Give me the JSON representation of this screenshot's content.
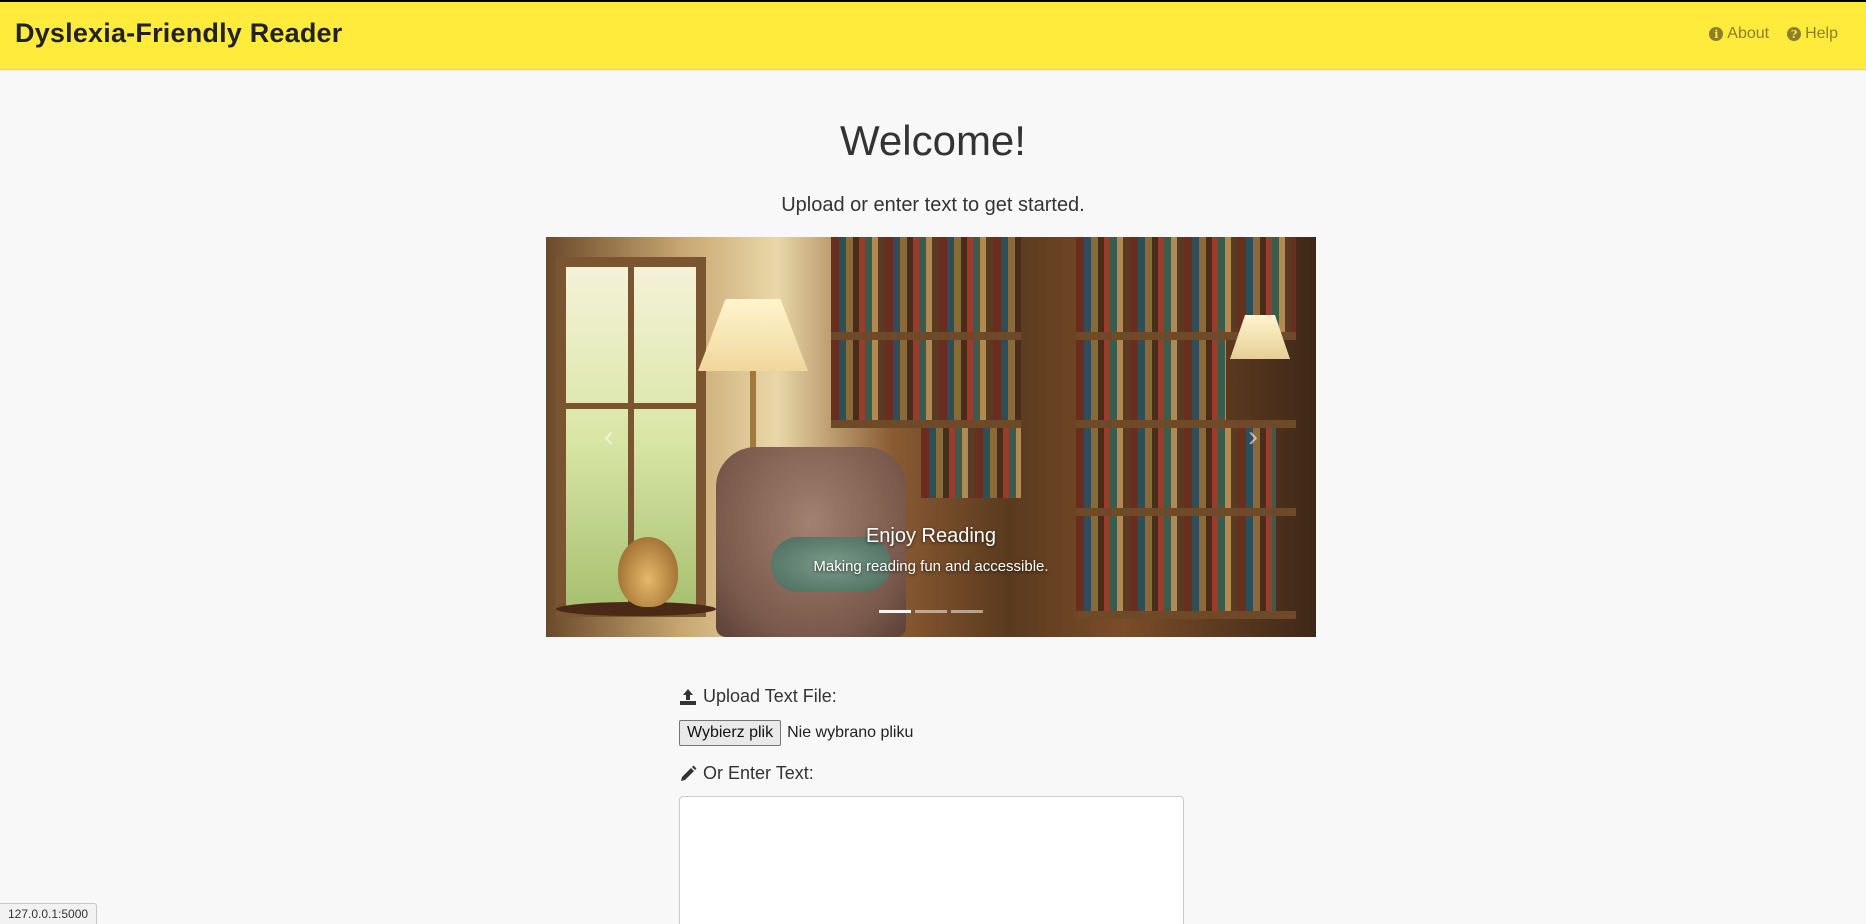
{
  "navbar": {
    "brand": "Dyslexia-Friendly Reader",
    "links": [
      {
        "label": "About",
        "icon": "info-circle-icon"
      },
      {
        "label": "Help",
        "icon": "question-circle-icon"
      }
    ],
    "background": "#ffeb3b"
  },
  "main": {
    "title": "Welcome!",
    "subtitle": "Upload or enter text to get started."
  },
  "carousel": {
    "caption_title": "Enjoy Reading",
    "caption_text": "Making reading fun and accessible.",
    "prev_icon": "chevron-left-icon",
    "next_icon": "chevron-right-icon",
    "active_slide": 0,
    "slide_count": 3
  },
  "form": {
    "upload_label": "Upload Text File:",
    "upload_icon": "upload-icon",
    "file_button": "Wybierz plik",
    "file_status": "Nie wybrano pliku",
    "text_label": "Or Enter Text:",
    "text_icon": "pencil-icon",
    "text_value": ""
  },
  "status_bar": {
    "url": "127.0.0.1:5000"
  }
}
